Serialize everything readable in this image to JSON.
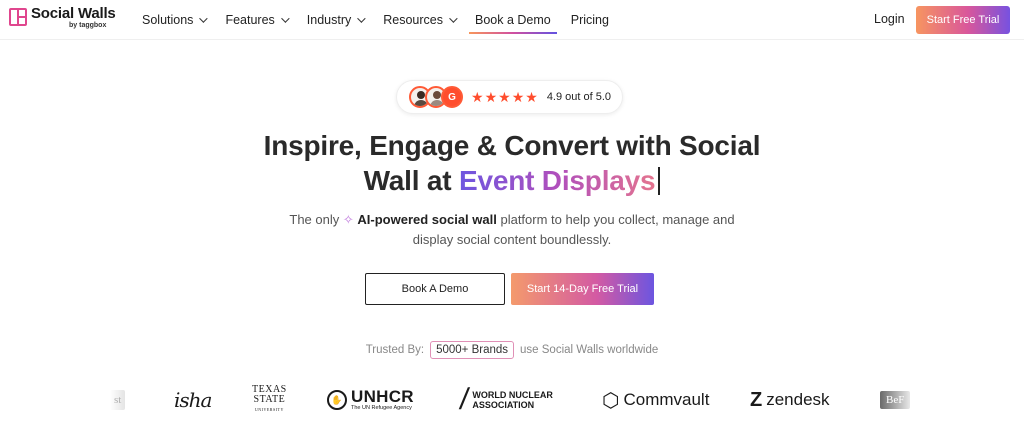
{
  "nav": {
    "logo_name": "Social Walls",
    "logo_by": "by taggbox",
    "items": [
      {
        "label": "Solutions",
        "dropdown": true
      },
      {
        "label": "Features",
        "dropdown": true
      },
      {
        "label": "Industry",
        "dropdown": true
      },
      {
        "label": "Resources",
        "dropdown": true
      },
      {
        "label": "Book a Demo",
        "dropdown": false,
        "active": true
      },
      {
        "label": "Pricing",
        "dropdown": false
      }
    ],
    "login": "Login",
    "cta": "Start Free Trial"
  },
  "rating": {
    "g2_label": "G",
    "stars": 5,
    "text": "4.9 out of 5.0"
  },
  "hero": {
    "title_line1": "Inspire, Engage & Convert with Social",
    "title_line2_plain": "Wall at ",
    "title_line2_highlight": "Event Displays",
    "subtitle_pre": "The only",
    "subtitle_bold": "AI-powered social wall",
    "subtitle_post": "platform to help you collect, manage and",
    "subtitle_line2": "display social content boundlessly.",
    "btn_demo": "Book A Demo",
    "btn_trial": "Start 14-Day Free Trial"
  },
  "trusted": {
    "prefix": "Trusted By:",
    "brands": "5000+ Brands",
    "suffix": "use Social Walls worldwide"
  },
  "logos": {
    "first_faded": "st",
    "isha": "isha",
    "texas_line1": "TEXAS",
    "texas_line2": "STATE",
    "texas_line3": "UNIVERSITY",
    "unhcr": "UNHCR",
    "unhcr_sub": "The UN Refugee Agency",
    "wna_line1": "WORLD NUCLEAR",
    "wna_line2": "ASSOCIATION",
    "commvault": "Commvault",
    "zendesk": "zendesk",
    "last_faded": "BeF"
  },
  "colors": {
    "accent_orange": "#f79560",
    "accent_pink": "#d9579b",
    "accent_purple": "#6c55e0",
    "star": "#ff4d2d"
  }
}
